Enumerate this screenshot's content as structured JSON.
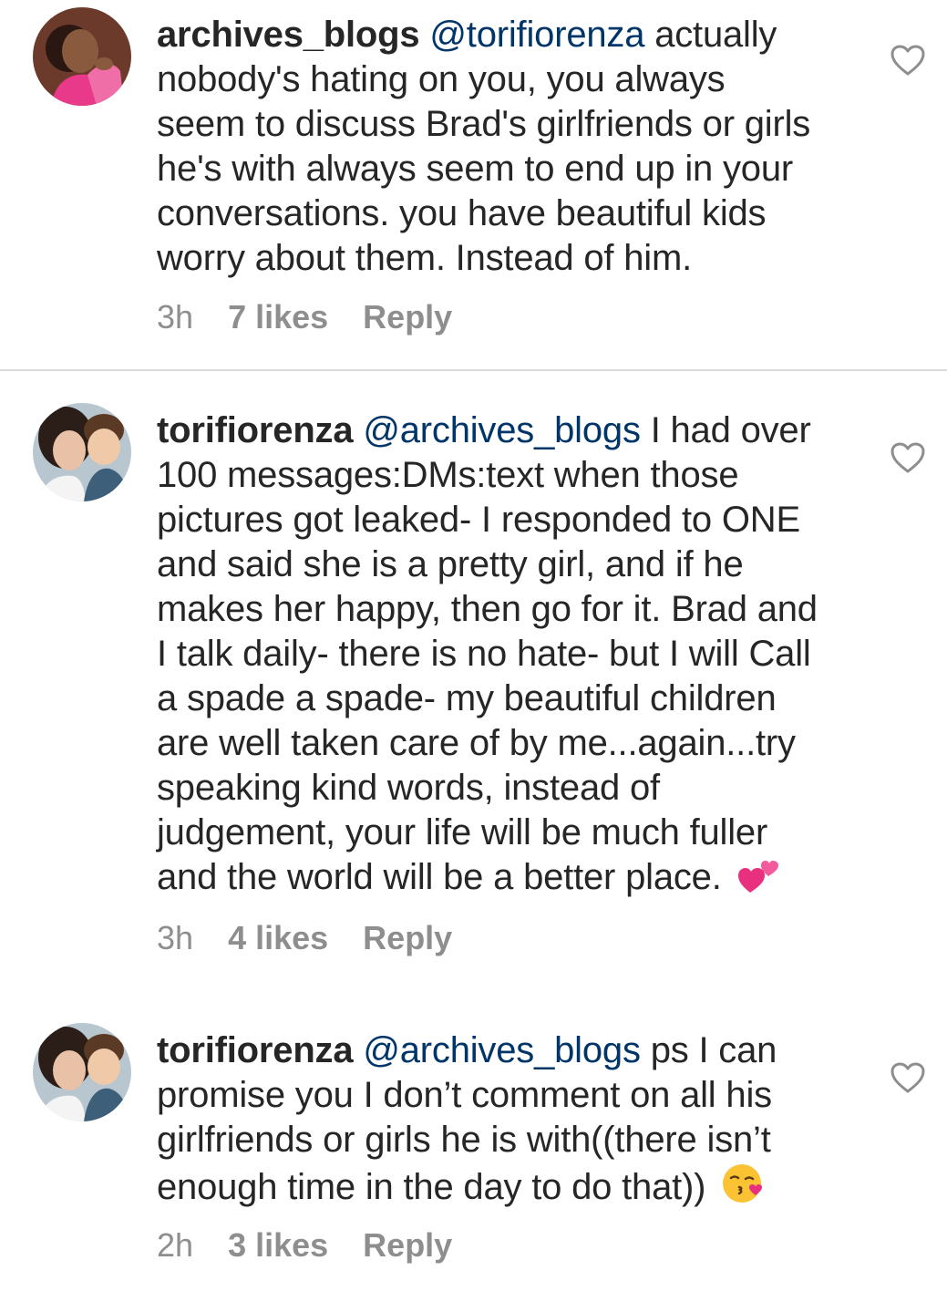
{
  "comments": [
    {
      "username": "archives_blogs",
      "mention": "@torifiorenza",
      "lines": [
        "actually",
        "nobody's hating on you, you always",
        "seem to discuss Brad's girlfriends or girls",
        "he's with always seem to end up in your",
        "conversations. you have beautiful kids",
        "worry about them.  Instead of him."
      ],
      "time": "3h",
      "likes": "7 likes",
      "reply": "Reply",
      "avatar_icon": "avatar-woman-pink-dress"
    },
    {
      "username": "torifiorenza",
      "mention": "@archives_blogs",
      "lines": [
        "I had over",
        "100 messages:DMs:text when those",
        "pictures got leaked- I responded to ONE",
        "and said she is a pretty girl, and if he",
        "makes her happy, then go for it. Brad and",
        "I talk daily- there is no hate- but I will Call",
        "a spade a spade- my beautiful children",
        "are well taken care of by me...again...try",
        "speaking kind words, instead of",
        "judgement, your life will be much fuller",
        "and the world will be a better place."
      ],
      "emoji": "two-hearts-emoji",
      "time": "3h",
      "likes": "4 likes",
      "reply": "Reply",
      "avatar_icon": "avatar-woman-with-child"
    },
    {
      "username": "torifiorenza",
      "mention": "@archives_blogs",
      "lines": [
        "ps I can",
        "promise you I don’t comment on all his",
        "girlfriends or girls he is with((there isn’t",
        "enough time in the day to do that))"
      ],
      "emoji": "kissing-face-emoji",
      "time": "2h",
      "likes": "3 likes",
      "reply": "Reply",
      "avatar_icon": "avatar-woman-with-child"
    }
  ],
  "colors": {
    "username": "#262626",
    "mention": "#003569",
    "meta": "#8e8e8e",
    "divider": "#dbdbdb",
    "heart_outline": "#8e8e8e"
  }
}
